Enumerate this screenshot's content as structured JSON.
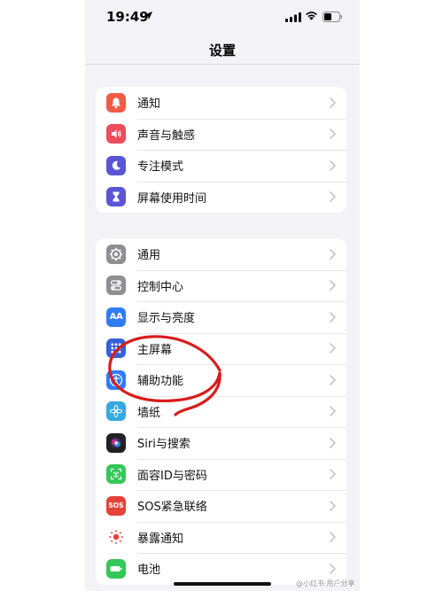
{
  "status_bar": {
    "time": "19:49"
  },
  "nav": {
    "title": "设置"
  },
  "groups": [
    {
      "items": [
        {
          "label": "通知",
          "icon": "bell-icon",
          "color": "#f05a47"
        },
        {
          "label": "声音与触感",
          "icon": "speaker-icon",
          "color": "#ee4b5c"
        },
        {
          "label": "专注模式",
          "icon": "moon-icon",
          "color": "#5a55d6"
        },
        {
          "label": "屏幕使用时间",
          "icon": "hourglass-icon",
          "color": "#5a55d6"
        }
      ]
    },
    {
      "items": [
        {
          "label": "通用",
          "icon": "gear-icon",
          "color": "#8e8e93"
        },
        {
          "label": "控制中心",
          "icon": "toggles-icon",
          "color": "#8e8e93"
        },
        {
          "label": "显示与亮度",
          "icon": "text-size-icon",
          "color": "#2f7cf6"
        },
        {
          "label": "主屏幕",
          "icon": "home-grid-icon",
          "color": "#3461d8"
        },
        {
          "label": "辅助功能",
          "icon": "accessibility-icon",
          "color": "#2f7cf6"
        },
        {
          "label": "墙纸",
          "icon": "flower-icon",
          "color": "#33a9e0"
        },
        {
          "label": "Siri与搜索",
          "icon": "siri-icon",
          "color": "#222222"
        },
        {
          "label": "面容ID与密码",
          "icon": "face-id-icon",
          "color": "#34c759"
        },
        {
          "label": "SOS紧急联络",
          "icon": "sos-icon",
          "color": "#e5433a"
        },
        {
          "label": "暴露通知",
          "icon": "exposure-icon",
          "color": "#ffffff"
        },
        {
          "label": "电池",
          "icon": "battery-icon",
          "color": "#34c759"
        }
      ]
    }
  ],
  "icon_text": {
    "display": "AA",
    "sos": "SOS"
  },
  "annotation": {
    "color": "#d91c1c"
  },
  "watermark": "@小红书·用户分享"
}
